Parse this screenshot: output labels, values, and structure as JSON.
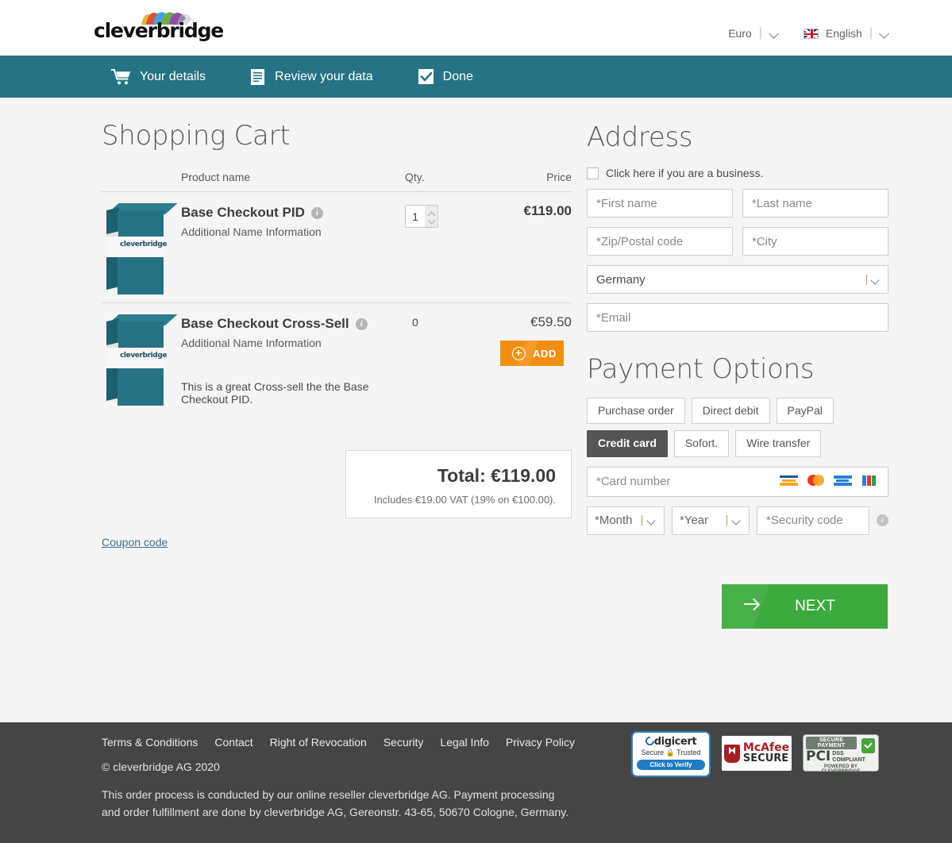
{
  "header": {
    "logo_text": "cleverbridge",
    "currency": "Euro",
    "language": "English",
    "currency_icon": "chevron-down-icon",
    "language_icon": "chevron-down-icon",
    "flag_icon": "uk-flag-icon"
  },
  "steps": [
    {
      "label": "Your details",
      "icon": "shopping-cart-icon",
      "active": true
    },
    {
      "label": "Review your data",
      "icon": "document-icon",
      "active": false
    },
    {
      "label": "Done",
      "icon": "checkbox-check-icon",
      "active": false
    }
  ],
  "cart": {
    "title": "Shopping Cart",
    "columns": {
      "name": "Product name",
      "qty": "Qty.",
      "price": "Price"
    },
    "items": [
      {
        "name": "Base Checkout PID",
        "subtitle": "Additional Name Information",
        "qty": "1",
        "price": "€119.00",
        "info_icon": "info-icon",
        "box_label": "cleverbridge"
      },
      {
        "name": "Base Checkout Cross-Sell",
        "subtitle": "Additional Name Information",
        "qty": "0",
        "price": "€59.50",
        "description": "This is a great Cross-sell the the Base Checkout PID.",
        "add_label": "ADD",
        "add_icon": "plus-circle-icon",
        "info_icon": "info-icon",
        "box_label": "cleverbridge"
      }
    ],
    "total_label": "Total: €119.00",
    "vat_note": "Includes €19.00 VAT (19% on €100.00).",
    "coupon_label": "Coupon code"
  },
  "address": {
    "title": "Address",
    "business_checkbox_label": "Click here if you are a business.",
    "first_name_placeholder": "*First name",
    "last_name_placeholder": "*Last name",
    "zip_placeholder": "*Zip/Postal code",
    "city_placeholder": "*City",
    "country_value": "Germany",
    "email_placeholder": "*Email"
  },
  "payment": {
    "title": "Payment Options",
    "methods": [
      {
        "label": "Purchase order",
        "active": false
      },
      {
        "label": "Direct debit",
        "active": false
      },
      {
        "label": "PayPal",
        "active": false
      },
      {
        "label": "Credit card",
        "active": true
      },
      {
        "label": "Sofort.",
        "active": false
      },
      {
        "label": "Wire transfer",
        "active": false
      }
    ],
    "card_number_placeholder": "*Card number",
    "card_brands": [
      "visa-icon",
      "mastercard-icon",
      "amex-icon",
      "jcb-icon"
    ],
    "month_placeholder": "*Month",
    "year_placeholder": "*Year",
    "security_code_placeholder": "*Security code",
    "security_info_icon": "info-icon"
  },
  "next_button": {
    "label": "NEXT",
    "icon": "arrow-right-icon",
    "color": "#3caa3c"
  },
  "footer": {
    "links": [
      "Terms & Conditions",
      "Contact",
      "Right of Revocation",
      "Security",
      "Legal Info",
      "Privacy Policy"
    ],
    "copyright": "© cleverbridge AG 2020",
    "note_line1": "This order process is conducted by our online reseller cleverbridge AG. Payment processing",
    "note_line2": "and order fulfillment are done by cleverbridge AG, Gereonstr. 43-65, 50670 Cologne, Germany.",
    "badges": {
      "digicert": {
        "name": "digicert",
        "name_bold": "cert",
        "sub": "Secure 🔒 Trusted",
        "cta": "Click to Verify"
      },
      "mcafee": {
        "line1": "McAfee",
        "line2": "SECURE"
      },
      "pci": {
        "top": "SECURE PAYMENT",
        "big": "PCI",
        "small1": "DSS",
        "small2": "COMPLIANT",
        "bottom": "POWERED BY CLEVERBRIDGE"
      }
    }
  },
  "colors": {
    "teal": "#267386",
    "orange": "#f18f12",
    "green": "#3caa3c",
    "footer": "#454545"
  }
}
